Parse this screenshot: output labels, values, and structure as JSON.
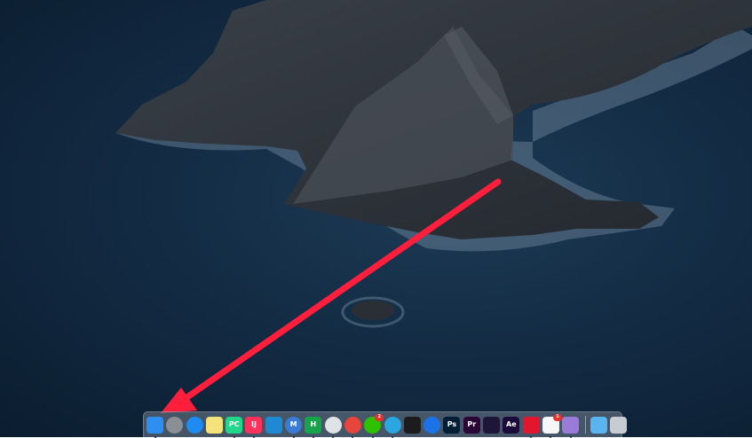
{
  "screen": {
    "title": "macOS Catalina desktop"
  },
  "annotation": {
    "type": "arrow",
    "color": "#ff1e3c",
    "points_to": "Finder"
  },
  "dock": {
    "apps": [
      {
        "name": "Finder",
        "icon": "finder-icon",
        "color": "#2d8ff0",
        "running": true
      },
      {
        "name": "Launchpad",
        "icon": "rocket-icon",
        "color": "#8a8f96",
        "running": false
      },
      {
        "name": "Safari",
        "icon": "compass-icon",
        "color": "#1d8bf1",
        "running": false
      },
      {
        "name": "Notes",
        "icon": "notes-icon",
        "color": "#f4e27a",
        "running": false
      },
      {
        "name": "PyCharm",
        "icon": "pycharm-icon",
        "label": "PC",
        "color": "#21d789",
        "running": true
      },
      {
        "name": "IntelliJ IDEA",
        "icon": "intellij-icon",
        "label": "IJ",
        "color": "#fe315d",
        "running": true
      },
      {
        "name": "Visual Studio Code",
        "icon": "vscode-icon",
        "color": "#1f8ad2",
        "running": false
      },
      {
        "name": "Maps",
        "icon": "m-app-icon",
        "label": "M",
        "color": "#3a7bd5",
        "running": true
      },
      {
        "name": "Typora",
        "icon": "h-app-icon",
        "label": "H",
        "color": "#16a34a",
        "running": true
      },
      {
        "name": "Messages",
        "icon": "chat-bubble-icon",
        "color": "#dfe3e6",
        "running": true
      },
      {
        "name": "Google Chrome",
        "icon": "chrome-icon",
        "color": "#e8453c",
        "running": true
      },
      {
        "name": "WeChat",
        "icon": "wechat-icon",
        "color": "#2dc100",
        "running": true,
        "badge": "2"
      },
      {
        "name": "Search",
        "icon": "magnifier-icon",
        "color": "#2aa7e0",
        "running": true
      },
      {
        "name": "Terminal",
        "icon": "terminal-icon",
        "color": "#1c1c1c",
        "running": false
      },
      {
        "name": "Location",
        "icon": "pin-icon",
        "color": "#1a73e8",
        "running": false
      },
      {
        "name": "Photoshop",
        "icon": "photoshop-icon",
        "label": "Ps",
        "color": "#001e36",
        "running": false
      },
      {
        "name": "Premiere Pro",
        "icon": "premiere-icon",
        "label": "Pr",
        "color": "#2a0634",
        "running": false
      },
      {
        "name": "Media Encoder",
        "icon": "media-encoder-icon",
        "color": "#1d1639",
        "running": false
      },
      {
        "name": "After Effects",
        "icon": "after-effects-icon",
        "label": "Ae",
        "color": "#1a0b3b",
        "running": false
      },
      {
        "name": "Netease Music",
        "icon": "music-wave-icon",
        "color": "#e4162d",
        "running": true
      },
      {
        "name": "QQ",
        "icon": "penguin-icon",
        "color": "#f6f6f6",
        "running": true,
        "badge": "1"
      },
      {
        "name": "Kite",
        "icon": "kite-icon",
        "color": "#9b7bd8",
        "running": true
      }
    ],
    "right": [
      {
        "name": "Downloads",
        "icon": "folder-icon",
        "color": "#5ab4f0"
      },
      {
        "name": "Trash",
        "icon": "trash-icon",
        "color": "#c7ccd2"
      }
    ]
  }
}
